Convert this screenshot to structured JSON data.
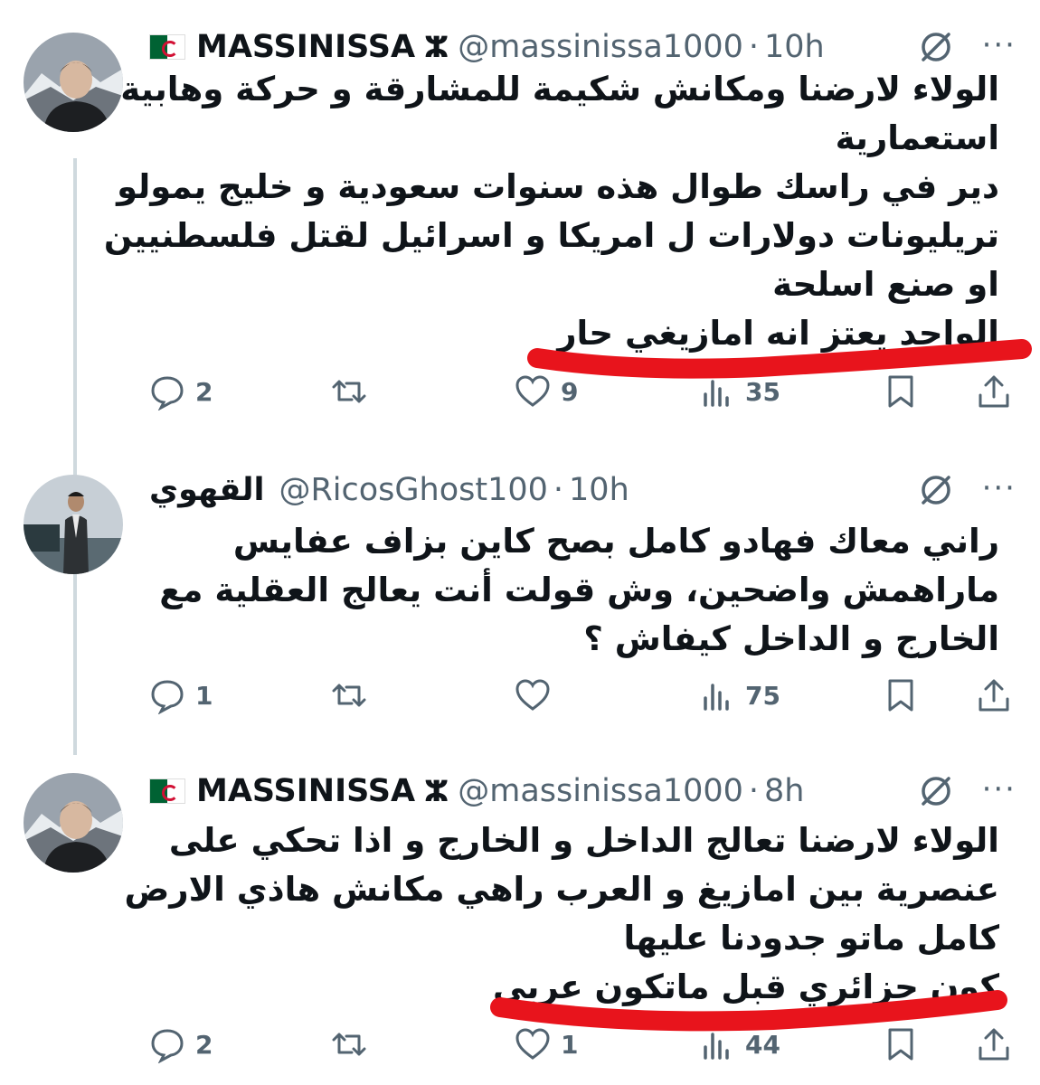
{
  "tweets": [
    {
      "name": "MASSINISSA",
      "amazigh_symbol": "ⵣ",
      "handle": "@massinissa1000",
      "dot": "·",
      "time": "10h",
      "lines": [
        "الولاء لارضنا ومكانش شكيمة للمشارقة و حركة وهابية",
        "استعمارية",
        "دير في راسك طوال هذه سنوات سعودية و خليج يمولو",
        "تريليونات دولارات ل امريكا و اسرائيل لقتل فلسطنيين",
        "او صنع اسلحة",
        "الواحد يعتز انه امازيغي حار"
      ],
      "replies": "2",
      "retweets": "",
      "likes": "9",
      "views": "35"
    },
    {
      "name": "القهوي",
      "handle": "@RicosGhost100",
      "dot": "·",
      "time": "10h",
      "lines": [
        "راني معاك فهادو كامل بصح كاين بزاف عفايس",
        "ماراهمش واضحين، وش قولت أنت يعالج العقلية مع",
        "الخارج و الداخل كيفاش ؟"
      ],
      "replies": "1",
      "retweets": "",
      "likes": "",
      "views": "75"
    },
    {
      "name": "MASSINISSA",
      "amazigh_symbol": "ⵣ",
      "handle": "@massinissa1000",
      "dot": "·",
      "time": "8h",
      "lines": [
        "الولاء لارضنا تعالج الداخل و الخارج و اذا تحكي على",
        "عنصرية بين امازيغ و العرب راهي مكانش هاذي الارض",
        "كامل ماتو جدودنا عليها",
        "كون جزائري قبل ماتكون عربي"
      ],
      "replies": "2",
      "retweets": "",
      "likes": "1",
      "views": "44"
    }
  ],
  "more_icon": "···",
  "colors": {
    "annotation": "#e8141c",
    "muted": "#536471",
    "thread": "#cfd9de"
  }
}
